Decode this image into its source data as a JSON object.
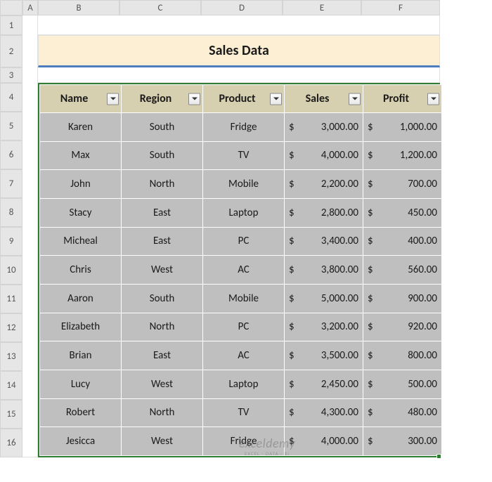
{
  "columns": [
    "A",
    "B",
    "C",
    "D",
    "E",
    "F"
  ],
  "rows": [
    "1",
    "2",
    "3",
    "4",
    "5",
    "6",
    "7",
    "8",
    "9",
    "10",
    "11",
    "12",
    "13",
    "14",
    "15",
    "16"
  ],
  "title": "Sales Data",
  "headers": [
    "Name",
    "Region",
    "Product",
    "Sales",
    "Profit"
  ],
  "data": [
    {
      "name": "Karen",
      "region": "South",
      "product": "Fridge",
      "sales": "3,000.00",
      "profit": "1,000.00"
    },
    {
      "name": "Max",
      "region": "South",
      "product": "TV",
      "sales": "4,000.00",
      "profit": "1,200.00"
    },
    {
      "name": "John",
      "region": "North",
      "product": "Mobile",
      "sales": "2,200.00",
      "profit": "700.00"
    },
    {
      "name": "Stacy",
      "region": "East",
      "product": "Laptop",
      "sales": "2,800.00",
      "profit": "450.00"
    },
    {
      "name": "Micheal",
      "region": "East",
      "product": "PC",
      "sales": "3,400.00",
      "profit": "400.00"
    },
    {
      "name": "Chris",
      "region": "West",
      "product": "AC",
      "sales": "3,800.00",
      "profit": "560.00"
    },
    {
      "name": "Aaron",
      "region": "South",
      "product": "Mobile",
      "sales": "5,000.00",
      "profit": "900.00"
    },
    {
      "name": "Elizabeth",
      "region": "North",
      "product": "PC",
      "sales": "3,200.00",
      "profit": "920.00"
    },
    {
      "name": "Brian",
      "region": "East",
      "product": "AC",
      "sales": "3,500.00",
      "profit": "800.00"
    },
    {
      "name": "Lucy",
      "region": "West",
      "product": "Laptop",
      "sales": "2,450.00",
      "profit": "500.00"
    },
    {
      "name": "Robert",
      "region": "North",
      "product": "TV",
      "sales": "4,300.00",
      "profit": "480.00"
    },
    {
      "name": "Jesicca",
      "region": "West",
      "product": "Fridge",
      "sales": "4,000.00",
      "profit": "300.00"
    }
  ],
  "watermark": {
    "big": "exceldemy",
    "small": "EXCEL · DATA · BI"
  },
  "chart_data": {
    "type": "table",
    "title": "Sales Data",
    "columns": [
      "Name",
      "Region",
      "Product",
      "Sales",
      "Profit"
    ],
    "rows": [
      [
        "Karen",
        "South",
        "Fridge",
        3000.0,
        1000.0
      ],
      [
        "Max",
        "South",
        "TV",
        4000.0,
        1200.0
      ],
      [
        "John",
        "North",
        "Mobile",
        2200.0,
        700.0
      ],
      [
        "Stacy",
        "East",
        "Laptop",
        2800.0,
        450.0
      ],
      [
        "Micheal",
        "East",
        "PC",
        3400.0,
        400.0
      ],
      [
        "Chris",
        "West",
        "AC",
        3800.0,
        560.0
      ],
      [
        "Aaron",
        "South",
        "Mobile",
        5000.0,
        900.0
      ],
      [
        "Elizabeth",
        "North",
        "PC",
        3200.0,
        920.0
      ],
      [
        "Brian",
        "East",
        "AC",
        3500.0,
        800.0
      ],
      [
        "Lucy",
        "West",
        "Laptop",
        2450.0,
        500.0
      ],
      [
        "Robert",
        "North",
        "TV",
        4300.0,
        480.0
      ],
      [
        "Jesicca",
        "West",
        "Fridge",
        4000.0,
        300.0
      ]
    ]
  }
}
